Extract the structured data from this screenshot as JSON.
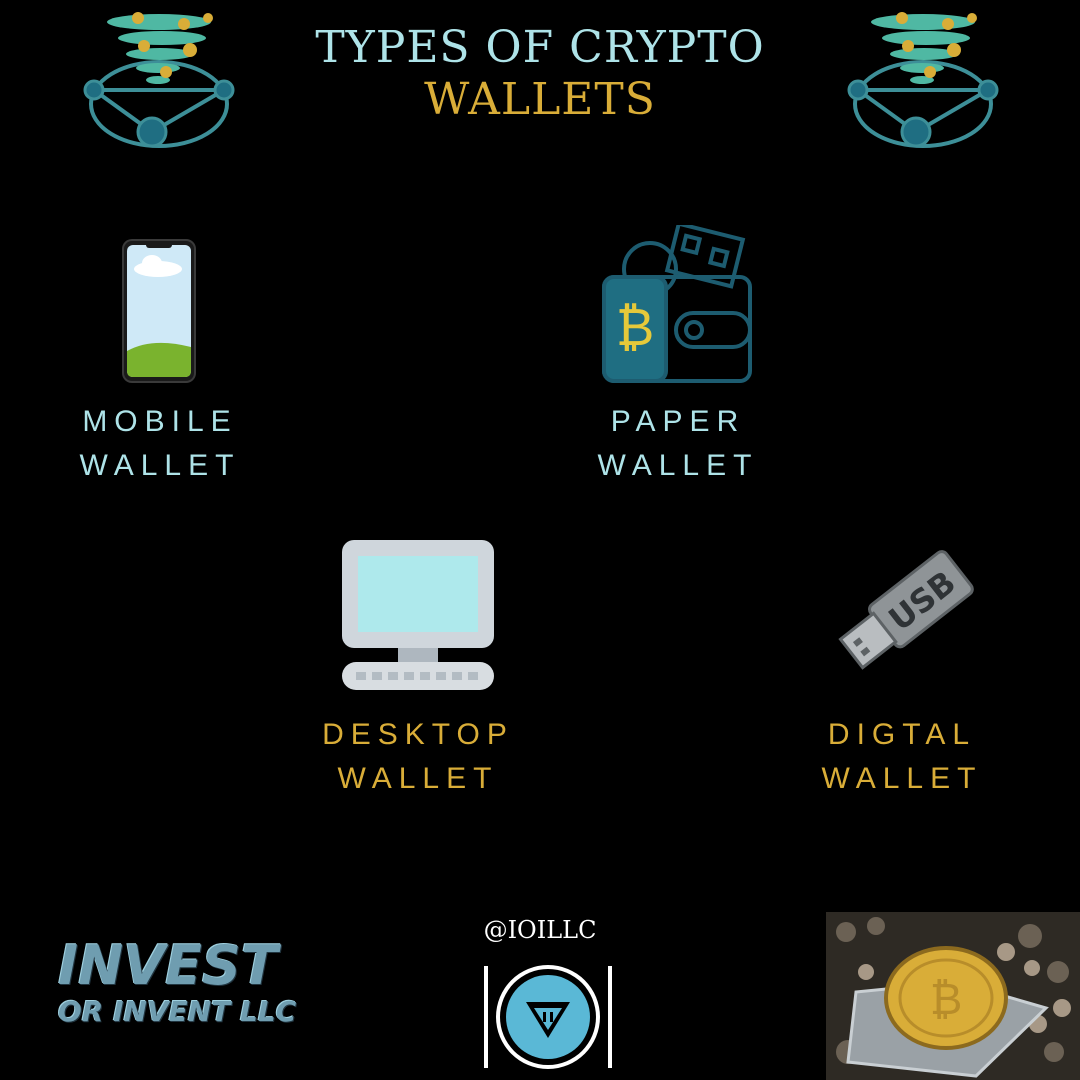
{
  "header": {
    "title_line_1": "TYPES OF CRYPTO",
    "title_line_2": "WALLETS"
  },
  "wallets": [
    {
      "line_1": "MOBILE",
      "line_2": "WALLET",
      "icon": "smartphone-icon"
    },
    {
      "line_1": "PAPER",
      "line_2": "WALLET",
      "icon": "bitcoin-wallet-icon"
    },
    {
      "line_1": "DESKTOP",
      "line_2": "WALLET",
      "icon": "desktop-computer-icon"
    },
    {
      "line_1": "DIGTAL",
      "line_2": "WALLET",
      "icon": "usb-drive-icon"
    }
  ],
  "footer": {
    "handle": "@IOILLC",
    "brand_line_1": "INVEST",
    "brand_line_2": "OR INVENT LLC"
  },
  "colors": {
    "background": "#000000",
    "accent_cyan": "#aee3e8",
    "accent_gold": "#d9ad38",
    "teal": "#1f6e82"
  }
}
